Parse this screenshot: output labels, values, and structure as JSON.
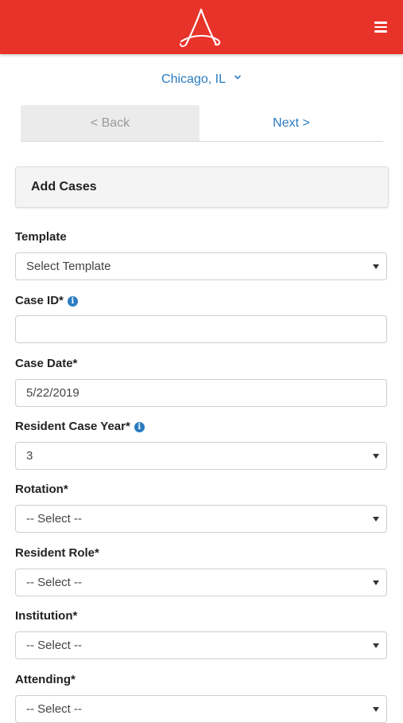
{
  "header": {
    "logo_icon": "brand-logo-icon",
    "menu_icon": "hamburger-menu-icon",
    "brand_color": "#e8332a"
  },
  "location": {
    "label": "Chicago, IL",
    "icon": "chevron-down-icon",
    "color": "#2a7cc0"
  },
  "pager": {
    "back_label": "< Back",
    "next_label": "Next >"
  },
  "panel": {
    "title": "Add Cases"
  },
  "form": {
    "template": {
      "label": "Template",
      "value": "Select Template"
    },
    "case_id": {
      "label": "Case ID*",
      "value": "",
      "info_icon": "info-icon"
    },
    "case_date": {
      "label": "Case Date*",
      "value": "5/22/2019"
    },
    "resident_case_year": {
      "label": "Resident Case Year*",
      "value": "3",
      "info_icon": "info-icon"
    },
    "rotation": {
      "label": "Rotation*",
      "value": "-- Select --"
    },
    "resident_role": {
      "label": "Resident Role*",
      "value": "-- Select --"
    },
    "institution": {
      "label": "Institution*",
      "value": "-- Select --"
    },
    "attending": {
      "label": "Attending*",
      "value": "-- Select --"
    }
  }
}
